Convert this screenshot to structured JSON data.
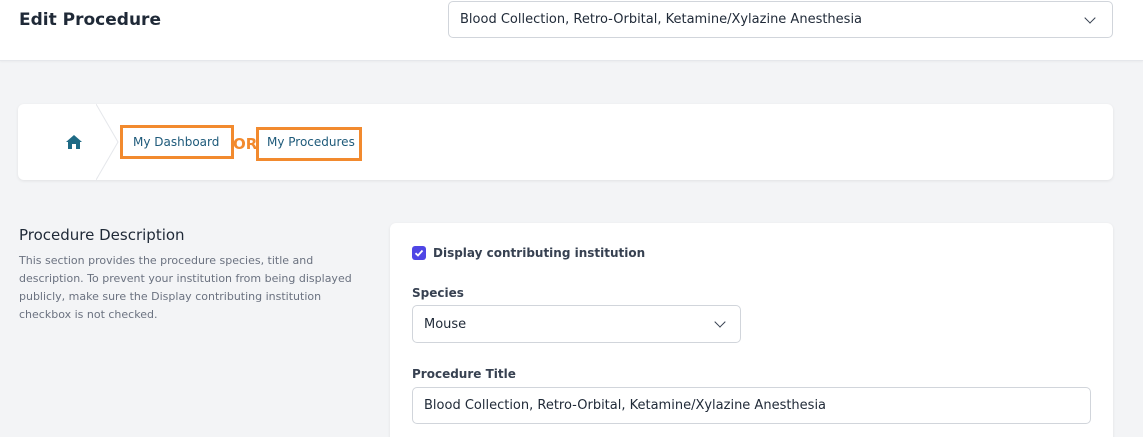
{
  "header": {
    "page_title": "Edit Procedure",
    "procedure_select_value": "Blood Collection, Retro-Orbital, Ketamine/Xylazine Anesthesia"
  },
  "breadcrumb": {
    "items": [
      {
        "label": "My Dashboard"
      },
      {
        "label": "My Procedures"
      }
    ],
    "annotation_text": "OR"
  },
  "section": {
    "title": "Procedure Description",
    "description": "This section provides the procedure species, title and description. To prevent your institution from being displayed publicly, make sure the Display contributing institution checkbox is not checked."
  },
  "form": {
    "display_institution_label": "Display contributing institution",
    "display_institution_checked": true,
    "species_label": "Species",
    "species_value": "Mouse",
    "procedure_title_label": "Procedure Title",
    "procedure_title_value": "Blood Collection, Retro-Orbital, Ketamine/Xylazine Anesthesia"
  },
  "colors": {
    "accent": "#4f46e5",
    "link": "#1e5a7a",
    "home_icon": "#1e6a85",
    "highlight": "#f28a2e"
  },
  "icons": [
    "home-icon",
    "chevron-down-icon",
    "checkmark-icon"
  ]
}
